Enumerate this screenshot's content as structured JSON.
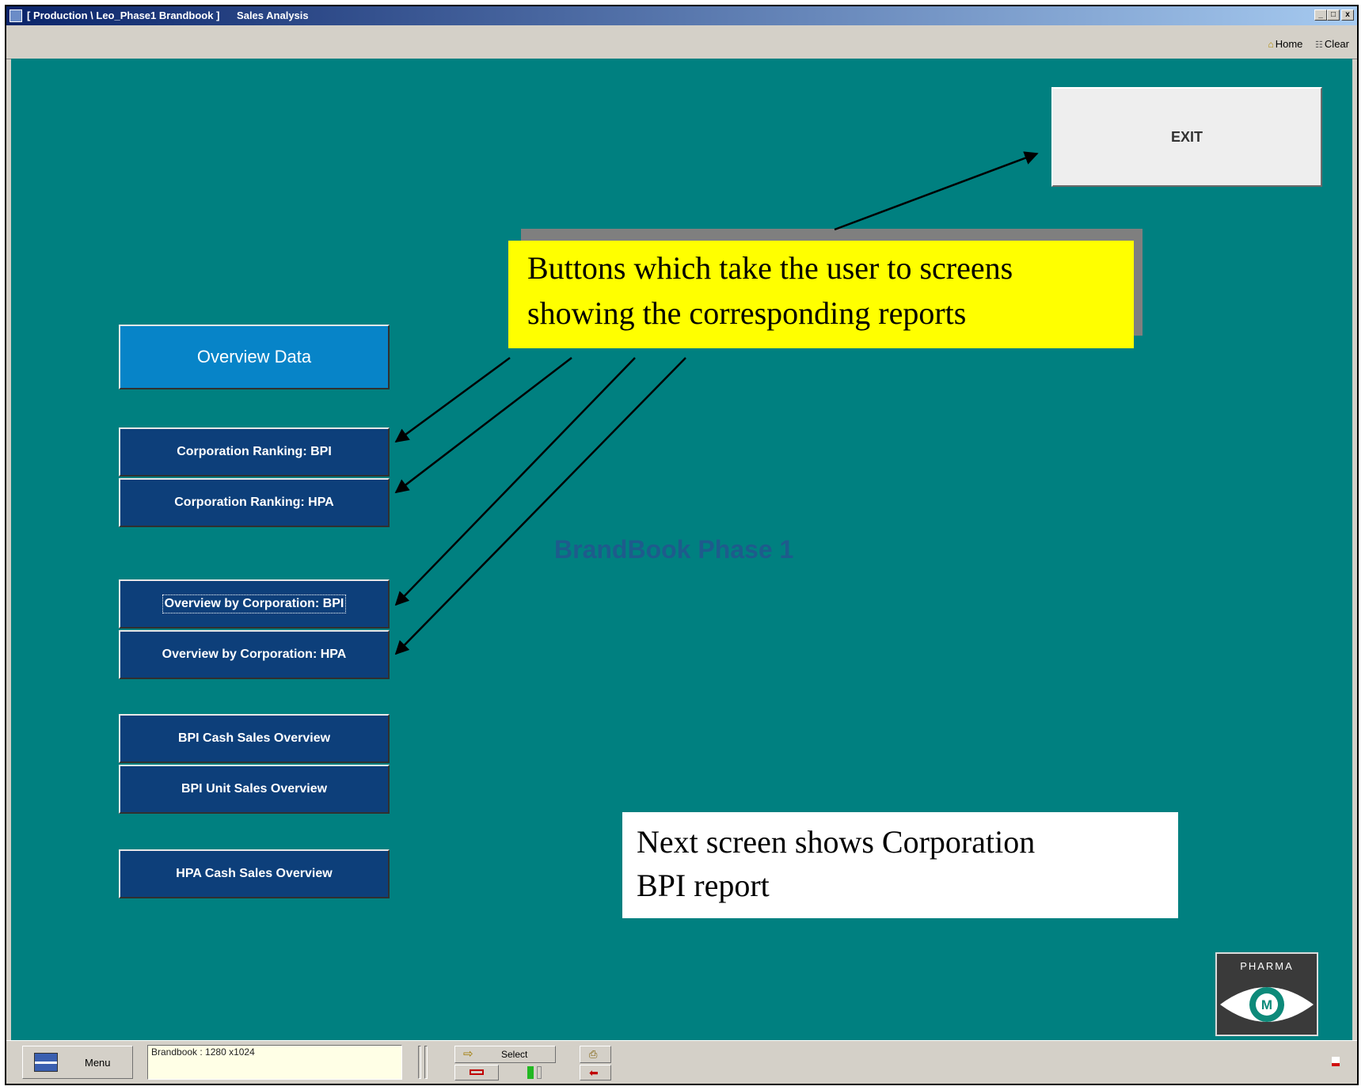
{
  "window": {
    "title_path": "[ Production \\ Leo_Phase1 Brandbook ]",
    "title_section": "Sales Analysis",
    "controls": {
      "minimize": "_",
      "maximize": "□",
      "close": "x"
    }
  },
  "menubar": {
    "home": "Home",
    "clear": "Clear"
  },
  "main": {
    "exit_label": "EXIT",
    "overview_label": "Overview Data",
    "buttons": [
      "Corporation Ranking: BPI",
      "Corporation Ranking: HPA",
      "Overview by Corporation: BPI",
      "Overview by Corporation: HPA",
      "BPI Cash Sales Overview",
      "BPI Unit Sales Overview",
      "HPA Cash Sales Overview"
    ],
    "brand_title": "BrandBook Phase 1",
    "logo_text": "PHARMA",
    "logo_mark": "M"
  },
  "annotations": {
    "callout_line1": "Buttons which take the user to screens",
    "callout_line2": "showing the corresponding reports",
    "note_line1": "Next screen shows Corporation",
    "note_line2": "BPI report"
  },
  "statusbar": {
    "menu_label": "Menu",
    "info": "Brandbook : 1280 x1024",
    "select_label": "Select"
  },
  "colors": {
    "background": "#008080",
    "nav_button": "#0d3f7a",
    "overview_button": "#0784c8",
    "callout": "#ffff00",
    "brand_title": "#1e5b8c"
  }
}
